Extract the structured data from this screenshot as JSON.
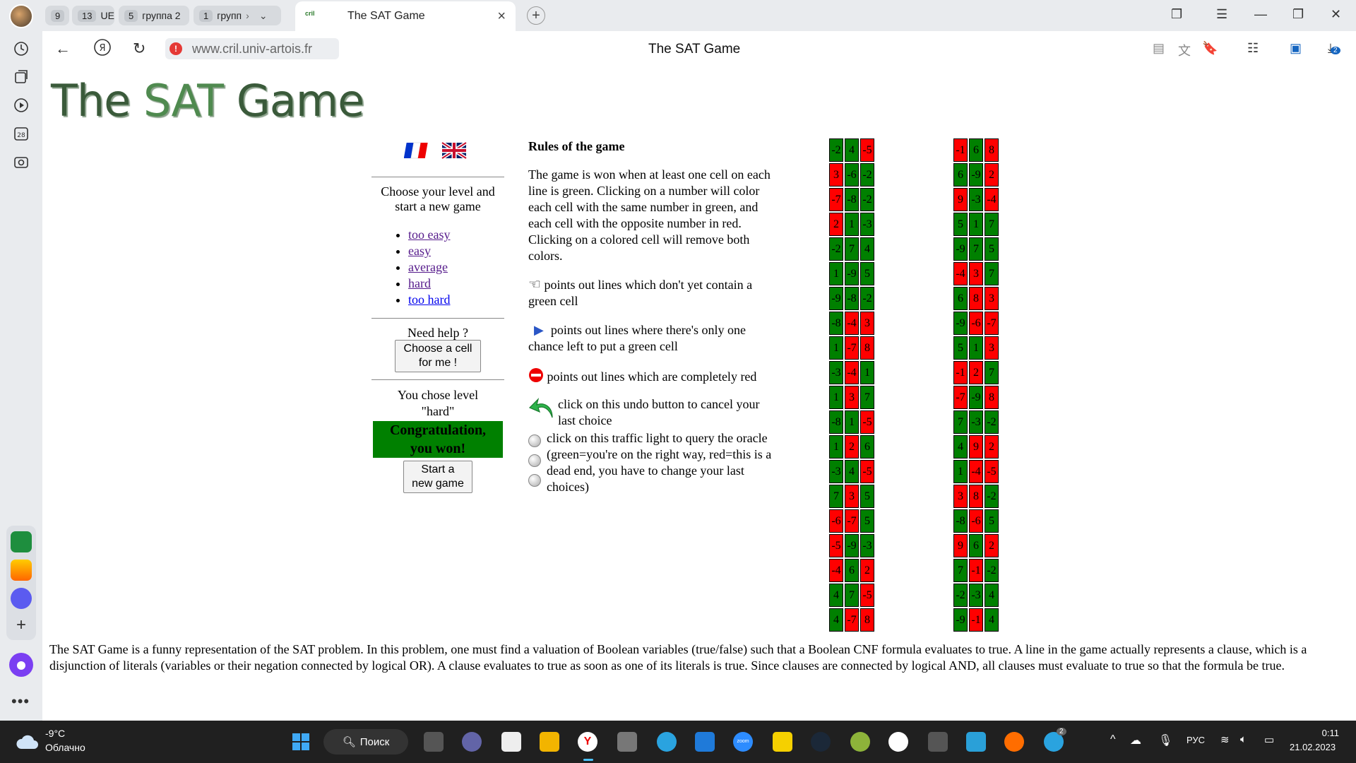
{
  "browser": {
    "tab_groups": [
      {
        "count": "9",
        "label": ""
      },
      {
        "count": "13",
        "label": "UE"
      },
      {
        "count": "5",
        "label": "группа 2"
      },
      {
        "count": "1",
        "label": "групп"
      }
    ],
    "active_tab": {
      "favicon_text": "cril",
      "title": "The SAT Game"
    },
    "url": "www.cril.univ-artois.fr",
    "page_title": "The SAT Game",
    "downloads_badge": "2",
    "sidebar_calendar_day": "28"
  },
  "page": {
    "logo": {
      "part1": "The ",
      "part2": "SAT",
      "part3": " Game"
    },
    "choose_level_text": "Choose your level and start a new game",
    "levels": [
      {
        "label": "too easy",
        "visited": true
      },
      {
        "label": "easy",
        "visited": true
      },
      {
        "label": "average",
        "visited": true
      },
      {
        "label": "hard",
        "visited": true
      },
      {
        "label": "too hard",
        "visited": false
      }
    ],
    "need_help": "Need help ?",
    "help_button": "Choose a cell for me !",
    "chosen_level_text": "You chose level \"hard\"",
    "congrats": "Congratulation, you won!",
    "new_game_button": "Start a new game",
    "rules": {
      "title": "Rules of the game",
      "intro": "The game is won when at least one cell on each line is green. Clicking on a number will color each cell with the same number in green, and each cell with the opposite number in red. Clicking on a colored cell will remove both colors.",
      "hand": "points out lines which don't yet contain a green cell",
      "arrow": "points out lines where there's only one chance left to put a green cell",
      "stop": "points out lines which are completely red",
      "undo": "click on this undo button to cancel your last choice",
      "oracle": "click on this traffic light to query the oracle (green=you're on the right way, red=this is a dead end, you have to change your last choices)"
    },
    "description": "The SAT Game is a funny representation of the SAT problem. In this problem, one must find a valuation of Boolean variables (true/false) such that a Boolean CNF formula evaluates to true. A line in the game actually represents a clause, which is a disjunction of literals (variables or their negation connected by logical OR). A clause evaluates to true as soon as one of its literals is true. Since clauses are connected by logical AND, all clauses must evaluate to true so that the formula be true."
  },
  "grids": [
    [
      [
        [
          "-2",
          "g"
        ],
        [
          "4",
          "g"
        ],
        [
          "-5",
          "r"
        ]
      ],
      [
        [
          "3",
          "r"
        ],
        [
          "-6",
          "g"
        ],
        [
          "-2",
          "g"
        ]
      ],
      [
        [
          "-7",
          "r"
        ],
        [
          "-8",
          "g"
        ],
        [
          "-2",
          "g"
        ]
      ],
      [
        [
          "2",
          "r"
        ],
        [
          "1",
          "g"
        ],
        [
          "-3",
          "g"
        ]
      ],
      [
        [
          "-2",
          "g"
        ],
        [
          "7",
          "g"
        ],
        [
          "4",
          "g"
        ]
      ],
      [
        [
          "1",
          "g"
        ],
        [
          "-9",
          "g"
        ],
        [
          "5",
          "g"
        ]
      ],
      [
        [
          "-9",
          "g"
        ],
        [
          "-8",
          "g"
        ],
        [
          "-2",
          "g"
        ]
      ],
      [
        [
          "-8",
          "g"
        ],
        [
          "-4",
          "r"
        ],
        [
          "3",
          "r"
        ]
      ],
      [
        [
          "1",
          "g"
        ],
        [
          "-7",
          "r"
        ],
        [
          "8",
          "r"
        ]
      ],
      [
        [
          "-3",
          "g"
        ],
        [
          "-4",
          "r"
        ],
        [
          "1",
          "g"
        ]
      ],
      [
        [
          "1",
          "g"
        ],
        [
          "3",
          "r"
        ],
        [
          "7",
          "g"
        ]
      ],
      [
        [
          "-8",
          "g"
        ],
        [
          "1",
          "g"
        ],
        [
          "-5",
          "r"
        ]
      ],
      [
        [
          "1",
          "g"
        ],
        [
          "2",
          "r"
        ],
        [
          "6",
          "g"
        ]
      ],
      [
        [
          "-3",
          "g"
        ],
        [
          "4",
          "g"
        ],
        [
          "-5",
          "r"
        ]
      ],
      [
        [
          "7",
          "g"
        ],
        [
          "3",
          "r"
        ],
        [
          "5",
          "g"
        ]
      ],
      [
        [
          "-6",
          "r"
        ],
        [
          "-7",
          "r"
        ],
        [
          "5",
          "g"
        ]
      ],
      [
        [
          "-5",
          "r"
        ],
        [
          "-9",
          "g"
        ],
        [
          "-3",
          "g"
        ]
      ],
      [
        [
          "-4",
          "r"
        ],
        [
          "6",
          "g"
        ],
        [
          "2",
          "r"
        ]
      ],
      [
        [
          "4",
          "g"
        ],
        [
          "7",
          "g"
        ],
        [
          "-5",
          "r"
        ]
      ],
      [
        [
          "4",
          "g"
        ],
        [
          "-7",
          "r"
        ],
        [
          "8",
          "r"
        ]
      ]
    ],
    [
      [
        [
          "-1",
          "r"
        ],
        [
          "6",
          "g"
        ],
        [
          "8",
          "r"
        ]
      ],
      [
        [
          "6",
          "g"
        ],
        [
          "-9",
          "g"
        ],
        [
          "2",
          "r"
        ]
      ],
      [
        [
          "9",
          "r"
        ],
        [
          "-3",
          "g"
        ],
        [
          "-4",
          "r"
        ]
      ],
      [
        [
          "5",
          "g"
        ],
        [
          "1",
          "g"
        ],
        [
          "7",
          "g"
        ]
      ],
      [
        [
          "-9",
          "g"
        ],
        [
          "7",
          "g"
        ],
        [
          "5",
          "g"
        ]
      ],
      [
        [
          "-4",
          "r"
        ],
        [
          "3",
          "r"
        ],
        [
          "7",
          "g"
        ]
      ],
      [
        [
          "6",
          "g"
        ],
        [
          "8",
          "r"
        ],
        [
          "3",
          "r"
        ]
      ],
      [
        [
          "-9",
          "g"
        ],
        [
          "-6",
          "r"
        ],
        [
          "-7",
          "r"
        ]
      ],
      [
        [
          "5",
          "g"
        ],
        [
          "1",
          "g"
        ],
        [
          "3",
          "r"
        ]
      ],
      [
        [
          "-1",
          "r"
        ],
        [
          "2",
          "r"
        ],
        [
          "7",
          "g"
        ]
      ],
      [
        [
          "-7",
          "r"
        ],
        [
          "-9",
          "g"
        ],
        [
          "8",
          "r"
        ]
      ],
      [
        [
          "7",
          "g"
        ],
        [
          "-3",
          "g"
        ],
        [
          "-2",
          "g"
        ]
      ],
      [
        [
          "4",
          "g"
        ],
        [
          "9",
          "r"
        ],
        [
          "2",
          "r"
        ]
      ],
      [
        [
          "1",
          "g"
        ],
        [
          "-4",
          "r"
        ],
        [
          "-5",
          "r"
        ]
      ],
      [
        [
          "3",
          "r"
        ],
        [
          "8",
          "r"
        ],
        [
          "-2",
          "g"
        ]
      ],
      [
        [
          "-8",
          "g"
        ],
        [
          "-6",
          "r"
        ],
        [
          "5",
          "g"
        ]
      ],
      [
        [
          "9",
          "r"
        ],
        [
          "6",
          "g"
        ],
        [
          "2",
          "r"
        ]
      ],
      [
        [
          "7",
          "g"
        ],
        [
          "-1",
          "r"
        ],
        [
          "-2",
          "g"
        ]
      ],
      [
        [
          "-2",
          "g"
        ],
        [
          "-3",
          "g"
        ],
        [
          "4",
          "g"
        ]
      ],
      [
        [
          "-9",
          "g"
        ],
        [
          "-1",
          "r"
        ],
        [
          "4",
          "g"
        ]
      ]
    ]
  ],
  "taskbar": {
    "weather_temp": "-9°C",
    "weather_desc": "Облачно",
    "search_label": "Поиск",
    "language": "РУС",
    "time": "0:11",
    "date": "21.02.2023",
    "telegram_badge": "2"
  },
  "colors": {
    "cell_green": "#008000",
    "cell_red": "#ff0000",
    "link": "#0000ee",
    "link_visited": "#551a8b"
  }
}
